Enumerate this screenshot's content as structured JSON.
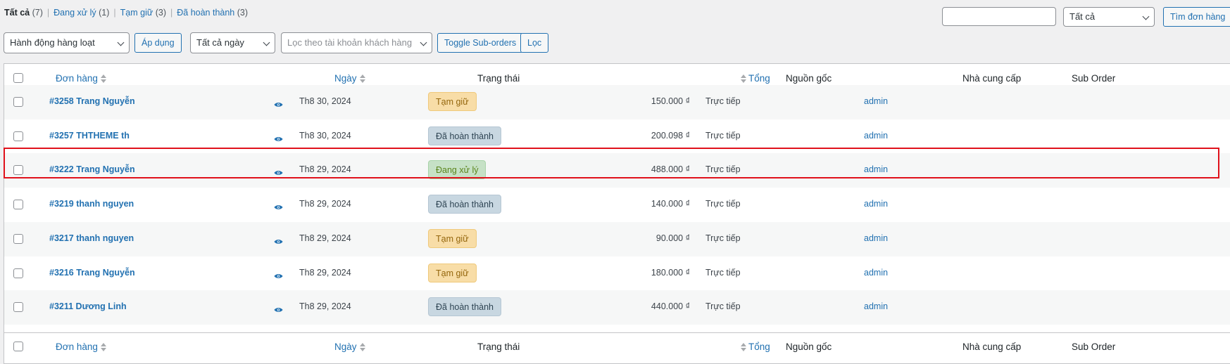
{
  "filters": {
    "all_label": "Tất cả",
    "all_count": "(7)",
    "processing_label": "Đang xử lý",
    "processing_count": "(1)",
    "onhold_label": "Tạm giữ",
    "onhold_count": "(3)",
    "completed_label": "Đã hoàn thành",
    "completed_count": "(3)"
  },
  "search": {
    "input_value": "",
    "scope_select": "Tất cả",
    "button_label": "Tìm đơn hàng"
  },
  "toolbar": {
    "bulk_action_select": "Hành động hàng loạt",
    "apply_label": "Áp dụng",
    "date_select": "Tất cả ngày",
    "customer_placeholder": "Lọc theo tài khoản khách hàng",
    "toggle_label": "Toggle Sub-orders",
    "filter_label": "Lọc"
  },
  "columns": {
    "order": "Đơn hàng",
    "date": "Ngày",
    "status": "Trạng thái",
    "total": "Tổng",
    "source": "Nguồn gốc",
    "vendor": "Nhà cung cấp",
    "suborder": "Sub Order"
  },
  "orders": [
    {
      "order": "#3258 Trang Nguyễn",
      "date": "Th8 30, 2024",
      "status": "Tạm giữ",
      "status_key": "on-hold",
      "total": "150.000 ₫",
      "source": "Trực tiếp",
      "vendor": "admin"
    },
    {
      "order": "#3257 THTHEME th",
      "date": "Th8 30, 2024",
      "status": "Đã hoàn thành",
      "status_key": "completed",
      "total": "200.098 ₫",
      "source": "Trực tiếp",
      "vendor": "admin"
    },
    {
      "order": "#3222 Trang Nguyễn",
      "date": "Th8 29, 2024",
      "status": "Đang xử lý",
      "status_key": "processing",
      "total": "488.000 ₫",
      "source": "Trực tiếp",
      "vendor": "admin"
    },
    {
      "order": "#3219 thanh nguyen",
      "date": "Th8 29, 2024",
      "status": "Đã hoàn thành",
      "status_key": "completed",
      "total": "140.000 ₫",
      "source": "Trực tiếp",
      "vendor": "admin"
    },
    {
      "order": "#3217 thanh nguyen",
      "date": "Th8 29, 2024",
      "status": "Tạm giữ",
      "status_key": "on-hold",
      "total": "90.000 ₫",
      "source": "Trực tiếp",
      "vendor": "admin"
    },
    {
      "order": "#3216 Trang Nguyễn",
      "date": "Th8 29, 2024",
      "status": "Tạm giữ",
      "status_key": "on-hold",
      "total": "180.000 ₫",
      "source": "Trực tiếp",
      "vendor": "admin"
    },
    {
      "order": "#3211 Dương Linh",
      "date": "Th8 29, 2024",
      "status": "Đã hoàn thành",
      "status_key": "completed",
      "total": "440.000 ₫",
      "source": "Trực tiếp",
      "vendor": "admin"
    }
  ],
  "icons": {
    "preview": "eye-icon",
    "sort": "sort-arrows-icon",
    "dropdown": "chevron-down-icon"
  },
  "colors": {
    "link": "#2271b1",
    "highlight": "#e0111b",
    "on_hold_bg": "#f8dda7",
    "completed_bg": "#c8d7e1",
    "processing_bg": "#c6e1c6"
  }
}
